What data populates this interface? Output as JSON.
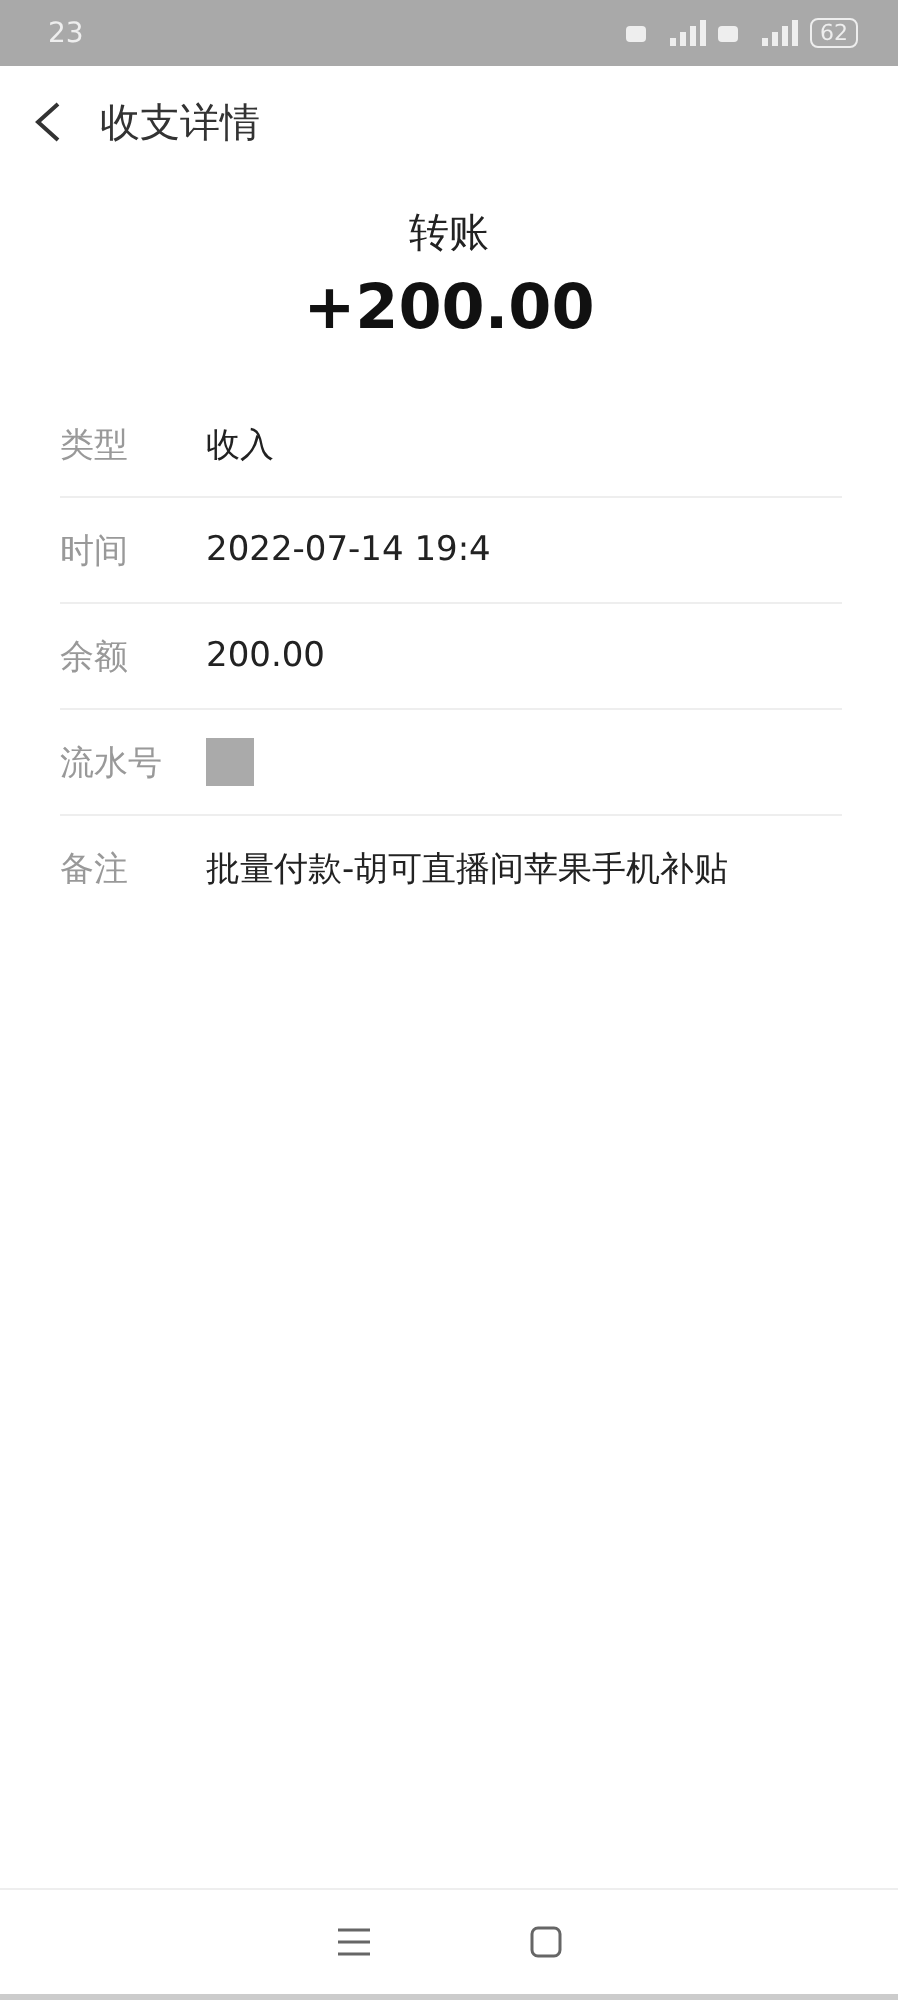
{
  "status_bar": {
    "time": "23",
    "battery": "62"
  },
  "header": {
    "title": "收支详情"
  },
  "summary": {
    "type": "转账",
    "amount": "+200.00"
  },
  "details": [
    {
      "label": "类型",
      "value": "收入"
    },
    {
      "label": "时间",
      "value": "2022-07-14 19:4"
    },
    {
      "label": "余额",
      "value": "200.00"
    },
    {
      "label": "流水号",
      "kind": "redacted"
    },
    {
      "label": "备注",
      "value": "批量付款-胡可直播间苹果手机补贴"
    }
  ]
}
